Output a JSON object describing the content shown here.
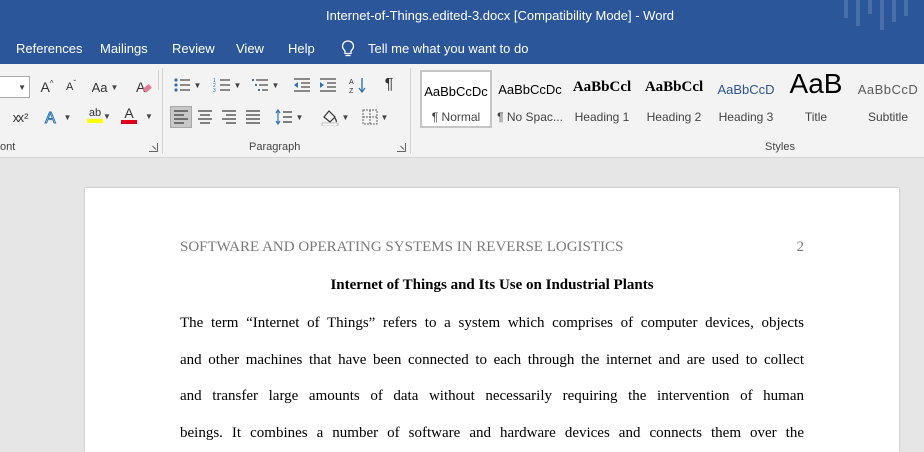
{
  "window": {
    "title": "Internet-of-Things.edited-3.docx  [Compatibility Mode]  -  Word"
  },
  "tabs": [
    {
      "label": "References"
    },
    {
      "label": "Mailings"
    },
    {
      "label": "Review"
    },
    {
      "label": "View"
    },
    {
      "label": "Help"
    }
  ],
  "tell_me": {
    "label": "Tell me what you want to do",
    "icon": "lightbulb-icon"
  },
  "ribbon": {
    "font_group_label": "ont",
    "paragraph_group_label": "Paragraph",
    "styles_group_label": "Styles",
    "font_buttons": {
      "grow_font": "A",
      "grow_font_sup": "^",
      "shrink_font": "A",
      "shrink_font_sup": "ˇ",
      "change_case": "Aa",
      "strikethrough_sub": "x",
      "superscript": "x²",
      "highlight_text": "ab",
      "highlight_color": "#ffff00",
      "font_color_letter": "A",
      "font_color": "#e0001b"
    },
    "styles": [
      {
        "preview": "AaBbCcDc",
        "label": "¶ Normal"
      },
      {
        "preview": "AaBbCcDc",
        "label": "¶ No Spac..."
      },
      {
        "preview": "AaBbCcl",
        "label": "Heading 1"
      },
      {
        "preview": "AaBbCcl",
        "label": "Heading 2"
      },
      {
        "preview": "AaBbCcD",
        "label": "Heading 3"
      },
      {
        "preview": "AaB",
        "label": "Title"
      },
      {
        "preview": "AaBbCcD",
        "label": "Subtitle"
      }
    ]
  },
  "document": {
    "running_head": "SOFTWARE AND OPERATING SYSTEMS IN REVERSE LOGISTICS",
    "page_number": "2",
    "title": "Internet of Things and Its Use on Industrial Plants",
    "lines": [
      "The term “Internet of Things” refers to a system which comprises of computer devices, objects",
      "and other machines that have been connected to each through the internet and are used to collect",
      "and transfer large amounts of data without necessarily requiring the intervention of human",
      "beings. It combines a number of software and hardware devices and connects them over the"
    ]
  },
  "colors": {
    "titlebar": "#2b579a",
    "ribbon": "#f3f3f3",
    "canvas": "#e6e6e6",
    "heading3_preview": "#2f5496"
  }
}
